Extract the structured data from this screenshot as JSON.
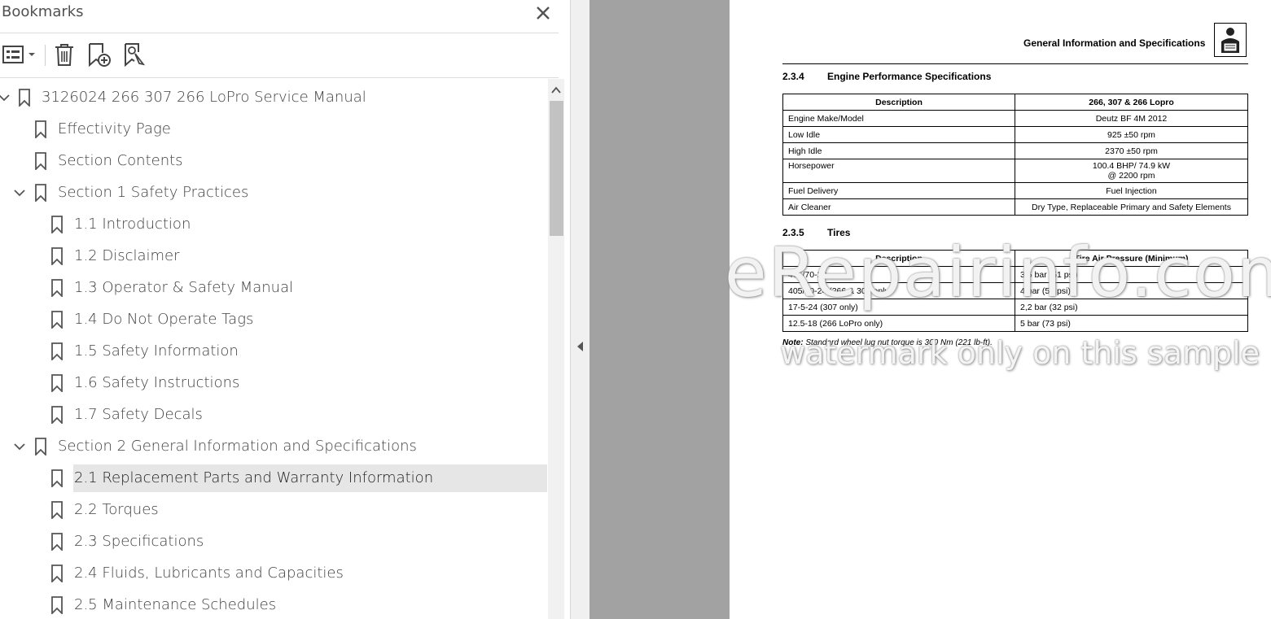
{
  "bookmarks_panel": {
    "title": "Bookmarks",
    "items": [
      {
        "label": "3126024 266 307 266 LoPro Service Manual",
        "level": 0,
        "expanded": true
      },
      {
        "label": "Effectivity Page",
        "level": 1
      },
      {
        "label": "Section Contents",
        "level": 1
      },
      {
        "label": "Section 1 Safety Practices",
        "level": 1,
        "expanded": true
      },
      {
        "label": "1.1 Introduction",
        "level": 2
      },
      {
        "label": "1.2 Disclaimer",
        "level": 2
      },
      {
        "label": "1.3 Operator & Safety Manual",
        "level": 2
      },
      {
        "label": "1.4 Do Not Operate Tags",
        "level": 2
      },
      {
        "label": "1.5 Safety Information",
        "level": 2
      },
      {
        "label": "1.6 Safety Instructions",
        "level": 2
      },
      {
        "label": "1.7 Safety Decals",
        "level": 2
      },
      {
        "label": "Section 2 General Information and Specifications",
        "level": 1,
        "expanded": true
      },
      {
        "label": "2.1 Replacement Parts and Warranty Information",
        "level": 2,
        "selected": true
      },
      {
        "label": "2.2 Torques",
        "level": 2
      },
      {
        "label": "2.3 Specifications",
        "level": 2
      },
      {
        "label": "2.4 Fluids, Lubricants and Capacities",
        "level": 2
      },
      {
        "label": "2.5 Maintenance Schedules",
        "level": 2
      }
    ]
  },
  "document": {
    "running_title": "General Information and Specifications",
    "section_234": {
      "number": "2.3.4",
      "title": "Engine Performance Specifications",
      "header": [
        "Description",
        "266, 307 & 266 Lopro"
      ],
      "rows": [
        [
          "Engine Make/Model",
          "Deutz BF 4M 2012"
        ],
        [
          "Low Idle",
          "925 ±50 rpm"
        ],
        [
          "High Idle",
          "2370 ±50 rpm"
        ],
        [
          "Horsepower",
          "100.4 BHP/ 74.9 kW",
          "@ 2200 rpm"
        ],
        [
          "Fuel Delivery",
          "Fuel Injection"
        ],
        [
          "Air Cleaner",
          "Dry Type, Replaceable Primary and Safety Elements"
        ]
      ]
    },
    "section_235": {
      "number": "2.3.5",
      "title": "Tires",
      "header": [
        "Description",
        "Tire Air Pressure (Minimum)"
      ],
      "rows": [
        [
          "405/70-20",
          "3,5 bar (51 psi)"
        ],
        [
          "405/70-24 (266 & 307 only)",
          "4 bar (58 psi)"
        ],
        [
          "17-5-24 (307 only)",
          "2,2 bar (32 psi)"
        ],
        [
          "12.5-18 (266 LoPro only)",
          "5 bar (73 psi)"
        ]
      ]
    },
    "note_label": "Note:",
    "note_text": "Standard wheel lug nut torque is 300 Nm (221 lb-ft)."
  },
  "watermark": {
    "line1": "eRepairinfo.com",
    "line2": "watermark only on this sample"
  }
}
